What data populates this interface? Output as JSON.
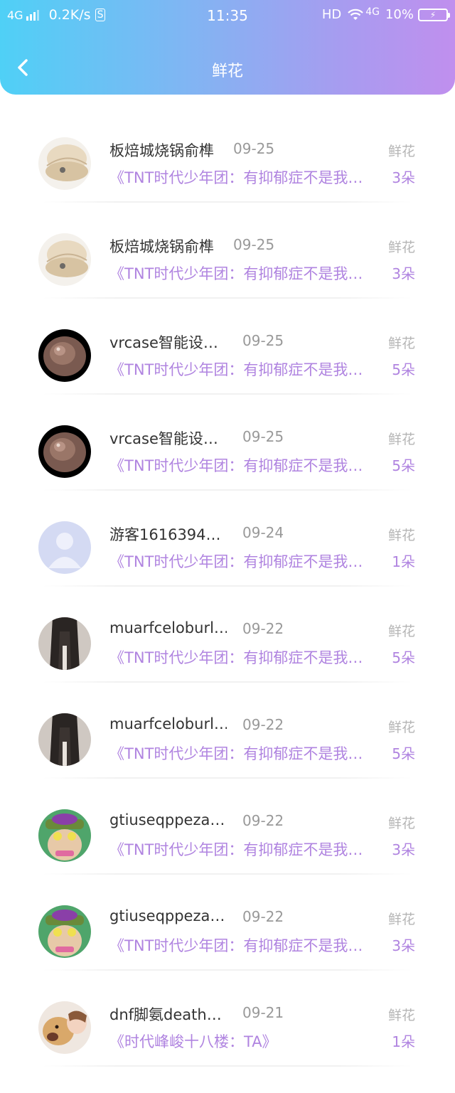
{
  "status_bar": {
    "network_left": "4G",
    "speed": "0.2K/s",
    "s_badge": "S",
    "time": "11:35",
    "hd": "HD",
    "network_right": "4G",
    "battery_pct": "10%"
  },
  "header": {
    "title": "鲜花",
    "back_icon": "chevron-left-icon"
  },
  "colors": {
    "header_gradient_start": "#4fd0f6",
    "header_gradient_end": "#c08fee",
    "accent": "#b084e0"
  },
  "records": [
    {
      "name": "板焙城烧锅俞榫",
      "date": "09-25",
      "gift_type": "鲜花",
      "desc": "《TNT时代少年团：有抑郁症不是我…",
      "count": "3朵",
      "avatar": "shell-avatar"
    },
    {
      "name": "板焙城烧锅俞榫",
      "date": "09-25",
      "gift_type": "鲜花",
      "desc": "《TNT时代少年团：有抑郁症不是我…",
      "count": "3朵",
      "avatar": "shell-avatar"
    },
    {
      "name": "vrcase智能设…",
      "date": "09-25",
      "gift_type": "鲜花",
      "desc": "《TNT时代少年团：有抑郁症不是我…",
      "count": "5朵",
      "avatar": "snail-avatar"
    },
    {
      "name": "vrcase智能设…",
      "date": "09-25",
      "gift_type": "鲜花",
      "desc": "《TNT时代少年团：有抑郁症不是我…",
      "count": "5朵",
      "avatar": "snail-avatar"
    },
    {
      "name": "游客1616394…",
      "date": "09-24",
      "gift_type": "鲜花",
      "desc": "《TNT时代少年团：有抑郁症不是我…",
      "count": "1朵",
      "avatar": "default-user-avatar"
    },
    {
      "name": "muarfceloburl…",
      "date": "09-22",
      "gift_type": "鲜花",
      "desc": "《TNT时代少年团：有抑郁症不是我…",
      "count": "5朵",
      "avatar": "dark-hair-avatar"
    },
    {
      "name": "muarfceloburl…",
      "date": "09-22",
      "gift_type": "鲜花",
      "desc": "《TNT时代少年团：有抑郁症不是我…",
      "count": "5朵",
      "avatar": "dark-hair-avatar"
    },
    {
      "name": "gtiuseqppeza…",
      "date": "09-22",
      "gift_type": "鲜花",
      "desc": "《TNT时代少年团：有抑郁症不是我…",
      "count": "3朵",
      "avatar": "cartoon-character-avatar"
    },
    {
      "name": "gtiuseqppeza…",
      "date": "09-22",
      "gift_type": "鲜花",
      "desc": "《TNT时代少年团：有抑郁症不是我…",
      "count": "3朵",
      "avatar": "cartoon-character-avatar"
    },
    {
      "name": "dnf脚氨death…",
      "date": "09-21",
      "gift_type": "鲜花",
      "desc": "《时代峰峻十八楼：TA》",
      "count": "1朵",
      "avatar": "dog-child-avatar"
    }
  ]
}
